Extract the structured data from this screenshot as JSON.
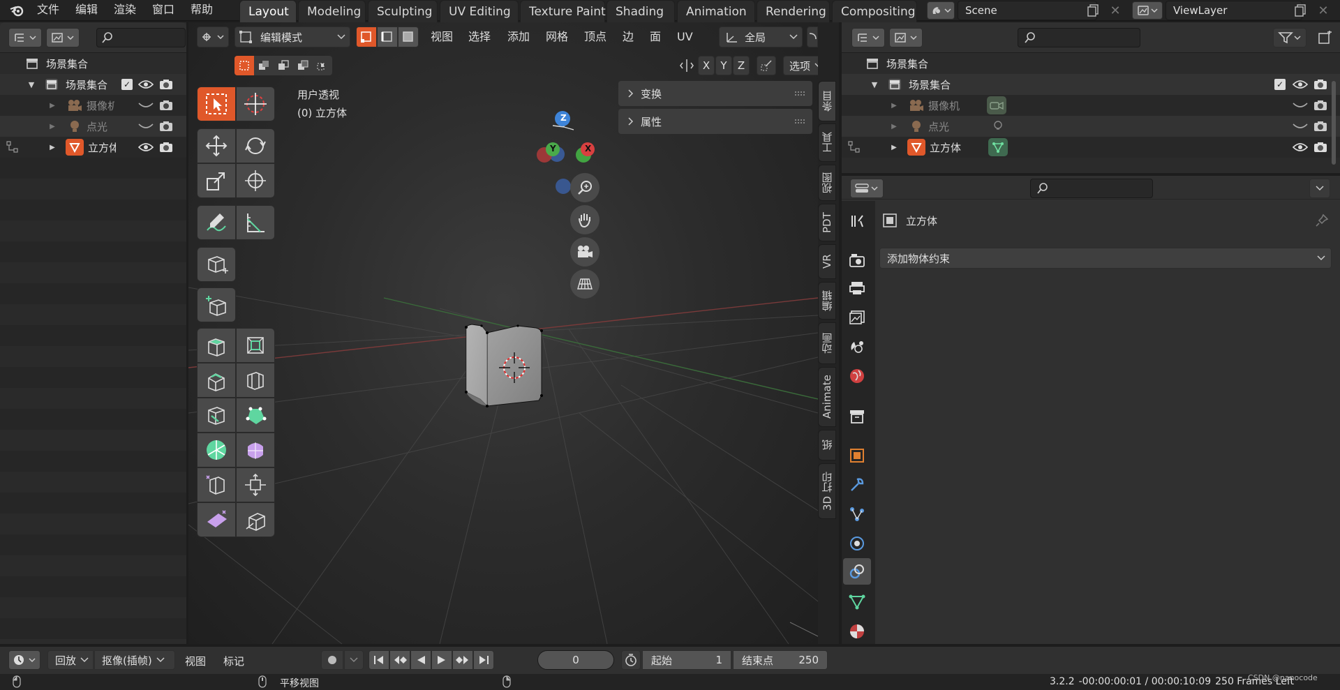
{
  "topbar": {
    "menus": [
      "文件",
      "编辑",
      "渲染",
      "窗口",
      "帮助"
    ],
    "workspaces": [
      "Layout",
      "Modeling",
      "Sculpting",
      "UV Editing",
      "Texture Paint",
      "Shading",
      "Animation",
      "Rendering",
      "Compositing"
    ],
    "scene_name": "Scene",
    "view_layer_name": "ViewLayer"
  },
  "outliner_left": {
    "search_placeholder": "",
    "rows": [
      {
        "label": "场景集合"
      },
      {
        "label": "场景集合"
      },
      {
        "label": "摄像机"
      },
      {
        "label": "点光"
      },
      {
        "label": "立方体"
      }
    ]
  },
  "viewport": {
    "mode_label": "编辑模式",
    "menus": [
      "视图",
      "选择",
      "添加",
      "网格",
      "顶点",
      "边",
      "面",
      "UV"
    ],
    "transform_orientation": "全局",
    "axes": [
      "X",
      "Y",
      "Z"
    ],
    "options_label": "选项",
    "view_name": "用户透视",
    "object_name": "(0) 立方体",
    "gizmo": {
      "z": "Z",
      "y": "Y",
      "x": "X"
    },
    "sidebar_panels": [
      "变换",
      "属性"
    ],
    "side_tabs": [
      "条目",
      "工具",
      "视图",
      "PDT",
      "VR",
      "编辑",
      "动画",
      "Animate",
      "纸",
      "3D 打印"
    ]
  },
  "outliner_right": {
    "rows": [
      {
        "label": "场景集合"
      },
      {
        "label": "场景集合"
      },
      {
        "label": "摄像机"
      },
      {
        "label": "点光"
      },
      {
        "label": "立方体"
      }
    ]
  },
  "properties": {
    "object_name": "立方体",
    "add_constraint_label": "添加物体约束"
  },
  "timeline": {
    "playback_label": "回放",
    "keying_label": "抠像(插帧)",
    "view_label": "视图",
    "marker_label": "标记",
    "current_frame": "0",
    "start_label": "起始",
    "start_value": "1",
    "end_label": "结束点",
    "end_value": "250"
  },
  "statusbar": {
    "pan_label": "平移视图",
    "version": "3.2.2",
    "time": "-00:00:00:01 / 00:00:10:09",
    "frames_left": "250 Frames Left",
    "watermark": "CSDN @nanocode"
  },
  "colors": {
    "accent": "#e0582a",
    "active_tab": "#3d3d3d",
    "selection": "#4772b3"
  }
}
